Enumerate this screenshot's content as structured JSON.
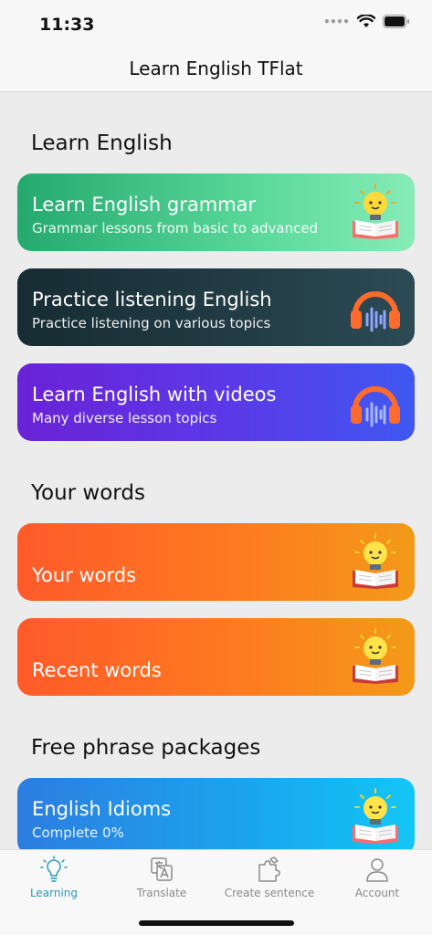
{
  "status": {
    "time": "11:33"
  },
  "nav": {
    "title": "Learn English TFlat"
  },
  "sections": {
    "learn": "Learn English",
    "words": "Your words",
    "phrases": "Free phrase packages"
  },
  "cards": {
    "grammar": {
      "title": "Learn English grammar",
      "subtitle": "Grammar lessons from basic to advanced",
      "icon": "lightbulb-book-icon"
    },
    "listening": {
      "title": "Practice listening English",
      "subtitle": "Practice listening on various topics",
      "icon": "headphones-icon"
    },
    "videos": {
      "title": "Learn English with videos",
      "subtitle": "Many diverse lesson topics",
      "icon": "headphones-icon"
    },
    "your_words": {
      "title": "Your words",
      "icon": "lightbulb-book-icon"
    },
    "recent_words": {
      "title": "Recent words",
      "icon": "lightbulb-book-icon"
    },
    "idioms": {
      "title": "English Idioms",
      "subtitle": "Complete 0%",
      "progress_percent": 0,
      "icon": "lightbulb-book-icon"
    }
  },
  "tabs": [
    {
      "label": "Learning",
      "icon": "lightbulb-icon",
      "active": true
    },
    {
      "label": "Translate",
      "icon": "translate-icon",
      "active": false
    },
    {
      "label": "Create sentence",
      "icon": "puzzle-icon",
      "active": false
    },
    {
      "label": "Account",
      "icon": "person-icon",
      "active": false
    }
  ],
  "colors": {
    "accent": "#2a9bb8",
    "green": "#25a96f",
    "dark": "#172c33",
    "purple": "#6a22d6",
    "orange": "#ff6a24",
    "blue": "#1aa6ee"
  }
}
